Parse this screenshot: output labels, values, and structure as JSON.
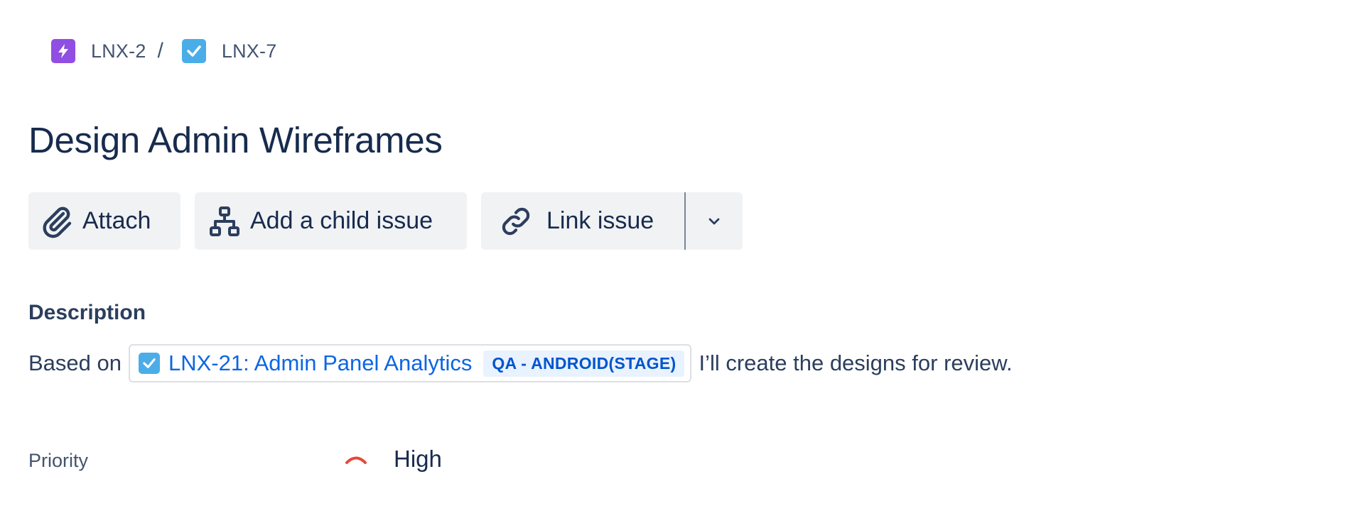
{
  "breadcrumb": {
    "parent": {
      "key": "LNX-2",
      "icon": "epic-lightning-icon",
      "color": "#904ee2"
    },
    "separator": "/",
    "current": {
      "key": "LNX-7",
      "icon": "task-check-icon",
      "color": "#4bade8"
    }
  },
  "issue": {
    "title": "Design Admin Wireframes"
  },
  "toolbar": {
    "attach_label": "Attach",
    "add_child_label": "Add a child issue",
    "link_issue_label": "Link issue"
  },
  "description": {
    "heading": "Description",
    "prefix": "Based on",
    "linked_issue": {
      "text": "LNX-21: Admin Panel Analytics",
      "status": "QA - ANDROID(STAGE)",
      "icon": "task-check-icon"
    },
    "suffix": "I’ll create the designs for review."
  },
  "fields": {
    "priority": {
      "label": "Priority",
      "value": "High",
      "icon": "priority-high-icon",
      "color": "#e5493a"
    }
  },
  "colors": {
    "text_primary": "#172b4d",
    "link": "#0c66e4",
    "button_bg": "#f1f2f4",
    "lozenge_bg": "#e9f2ff",
    "lozenge_text": "#0055cc"
  }
}
